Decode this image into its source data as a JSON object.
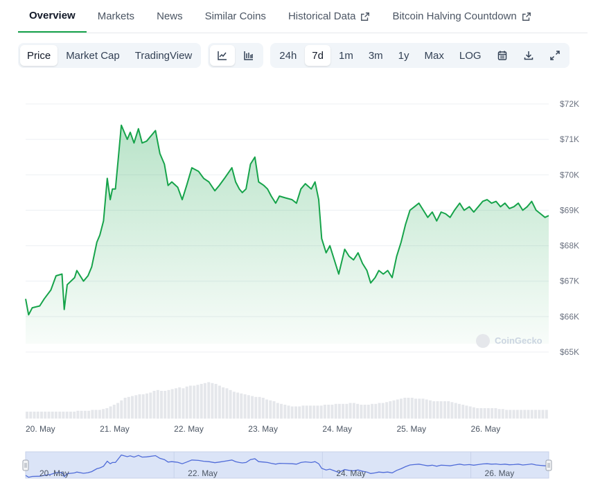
{
  "tabs": [
    {
      "label": "Overview",
      "active": true,
      "external": false
    },
    {
      "label": "Markets",
      "active": false,
      "external": false
    },
    {
      "label": "News",
      "active": false,
      "external": false
    },
    {
      "label": "Similar Coins",
      "active": false,
      "external": false
    },
    {
      "label": "Historical Data",
      "active": false,
      "external": true
    },
    {
      "label": "Bitcoin Halving Countdown",
      "active": false,
      "external": true
    }
  ],
  "toolbar": {
    "metric_buttons": [
      {
        "label": "Price",
        "active": true
      },
      {
        "label": "Market Cap",
        "active": false
      },
      {
        "label": "TradingView",
        "active": false
      }
    ],
    "chart_type_icons": [
      {
        "icon": "line-chart-icon",
        "active": true
      },
      {
        "icon": "candlestick-chart-icon",
        "active": false
      }
    ],
    "range_buttons": [
      {
        "label": "24h",
        "active": false
      },
      {
        "label": "7d",
        "active": true
      },
      {
        "label": "1m",
        "active": false
      },
      {
        "label": "3m",
        "active": false
      },
      {
        "label": "1y",
        "active": false
      },
      {
        "label": "Max",
        "active": false
      },
      {
        "label": "LOG",
        "active": false
      }
    ],
    "action_icons": [
      "calendar-icon",
      "download-icon",
      "fullscreen-icon"
    ]
  },
  "watermark": "CoinGecko",
  "colors": {
    "accent": "#16a34a",
    "line": "#16a34a",
    "navigator_line": "#4f6bd8",
    "navigator_fill": "#dbe4f7"
  },
  "chart_data": {
    "type": "line",
    "y_ticks": [
      "$72K",
      "$71K",
      "$70K",
      "$69K",
      "$68K",
      "$67K",
      "$66K",
      "$65K"
    ],
    "y_tick_values": [
      72000,
      71000,
      70000,
      69000,
      68000,
      67000,
      66000,
      65000
    ],
    "ylim": [
      65000,
      72000
    ],
    "x_ticks": [
      "20. May",
      "21. May",
      "22. May",
      "23. May",
      "24. May",
      "25. May",
      "26. May"
    ],
    "x_tick_values": [
      0,
      1,
      2,
      3,
      4,
      5,
      6
    ],
    "xlim": [
      0,
      7.05
    ],
    "navigator_ticks": [
      "20. May",
      "22. May",
      "24. May",
      "26. May"
    ],
    "navigator_tick_values": [
      0,
      2,
      4,
      6
    ],
    "grid": true,
    "series": [
      {
        "values": [
          [
            0.0,
            66500
          ],
          [
            0.04,
            66050
          ],
          [
            0.09,
            66250
          ],
          [
            0.19,
            66300
          ],
          [
            0.25,
            66500
          ],
          [
            0.34,
            66750
          ],
          [
            0.41,
            67150
          ],
          [
            0.49,
            67200
          ],
          [
            0.52,
            66200
          ],
          [
            0.56,
            66900
          ],
          [
            0.66,
            67100
          ],
          [
            0.69,
            67300
          ],
          [
            0.78,
            67000
          ],
          [
            0.84,
            67150
          ],
          [
            0.89,
            67400
          ],
          [
            0.96,
            68100
          ],
          [
            1.0,
            68300
          ],
          [
            1.05,
            68700
          ],
          [
            1.1,
            69900
          ],
          [
            1.14,
            69300
          ],
          [
            1.17,
            69600
          ],
          [
            1.21,
            69600
          ],
          [
            1.25,
            70500
          ],
          [
            1.29,
            71400
          ],
          [
            1.37,
            71000
          ],
          [
            1.41,
            71200
          ],
          [
            1.46,
            70900
          ],
          [
            1.52,
            71300
          ],
          [
            1.57,
            70900
          ],
          [
            1.63,
            70950
          ],
          [
            1.75,
            71250
          ],
          [
            1.81,
            70600
          ],
          [
            1.87,
            70300
          ],
          [
            1.92,
            69700
          ],
          [
            1.97,
            69800
          ],
          [
            2.05,
            69650
          ],
          [
            2.11,
            69300
          ],
          [
            2.17,
            69700
          ],
          [
            2.24,
            70200
          ],
          [
            2.33,
            70100
          ],
          [
            2.4,
            69900
          ],
          [
            2.47,
            69800
          ],
          [
            2.55,
            69550
          ],
          [
            2.61,
            69700
          ],
          [
            2.68,
            69900
          ],
          [
            2.78,
            70200
          ],
          [
            2.83,
            69800
          ],
          [
            2.88,
            69600
          ],
          [
            2.92,
            69500
          ],
          [
            2.97,
            69600
          ],
          [
            3.03,
            70300
          ],
          [
            3.09,
            70500
          ],
          [
            3.14,
            69800
          ],
          [
            3.21,
            69700
          ],
          [
            3.26,
            69600
          ],
          [
            3.31,
            69400
          ],
          [
            3.37,
            69200
          ],
          [
            3.42,
            69400
          ],
          [
            3.5,
            69350
          ],
          [
            3.59,
            69300
          ],
          [
            3.65,
            69200
          ],
          [
            3.71,
            69600
          ],
          [
            3.77,
            69750
          ],
          [
            3.85,
            69600
          ],
          [
            3.9,
            69800
          ],
          [
            3.95,
            69300
          ],
          [
            3.99,
            68200
          ],
          [
            4.05,
            67800
          ],
          [
            4.1,
            68000
          ],
          [
            4.16,
            67600
          ],
          [
            4.22,
            67200
          ],
          [
            4.3,
            67900
          ],
          [
            4.36,
            67700
          ],
          [
            4.42,
            67600
          ],
          [
            4.48,
            67800
          ],
          [
            4.54,
            67500
          ],
          [
            4.6,
            67300
          ],
          [
            4.65,
            66950
          ],
          [
            4.71,
            67100
          ],
          [
            4.76,
            67300
          ],
          [
            4.82,
            67200
          ],
          [
            4.88,
            67300
          ],
          [
            4.94,
            67100
          ],
          [
            5.0,
            67700
          ],
          [
            5.06,
            68100
          ],
          [
            5.12,
            68600
          ],
          [
            5.18,
            69000
          ],
          [
            5.24,
            69100
          ],
          [
            5.3,
            69200
          ],
          [
            5.36,
            69000
          ],
          [
            5.42,
            68800
          ],
          [
            5.48,
            68950
          ],
          [
            5.54,
            68700
          ],
          [
            5.6,
            68950
          ],
          [
            5.66,
            68900
          ],
          [
            5.72,
            68800
          ],
          [
            5.78,
            69000
          ],
          [
            5.85,
            69200
          ],
          [
            5.91,
            69000
          ],
          [
            5.98,
            69100
          ],
          [
            6.04,
            68950
          ],
          [
            6.1,
            69100
          ],
          [
            6.16,
            69250
          ],
          [
            6.22,
            69300
          ],
          [
            6.28,
            69200
          ],
          [
            6.34,
            69250
          ],
          [
            6.4,
            69100
          ],
          [
            6.46,
            69200
          ],
          [
            6.52,
            69050
          ],
          [
            6.58,
            69100
          ],
          [
            6.64,
            69200
          ],
          [
            6.7,
            69000
          ],
          [
            6.76,
            69100
          ],
          [
            6.82,
            69250
          ],
          [
            6.88,
            69000
          ],
          [
            6.94,
            68900
          ],
          [
            7.0,
            68800
          ],
          [
            7.05,
            68850
          ]
        ]
      }
    ],
    "volume": [
      8,
      8,
      8,
      8,
      8,
      8,
      8,
      8,
      8,
      8,
      8,
      8,
      8,
      8,
      9,
      9,
      9,
      9,
      10,
      10,
      10,
      11,
      12,
      14,
      16,
      18,
      21,
      24,
      25,
      26,
      27,
      28,
      28,
      29,
      30,
      32,
      33,
      32,
      32,
      33,
      34,
      35,
      36,
      35,
      37,
      38,
      38,
      39,
      40,
      41,
      42,
      41,
      40,
      38,
      36,
      35,
      33,
      31,
      30,
      29,
      28,
      27,
      26,
      25,
      25,
      24,
      22,
      21,
      20,
      18,
      17,
      16,
      15,
      14,
      14,
      14,
      15,
      15,
      15,
      15,
      15,
      15,
      16,
      16,
      16,
      17,
      17,
      17,
      17,
      18,
      18,
      17,
      16,
      16,
      16,
      17,
      17,
      18,
      18,
      19,
      20,
      21,
      22,
      23,
      24,
      24,
      24,
      23,
      23,
      23,
      22,
      21,
      20,
      20,
      20,
      20,
      20,
      19,
      18,
      17,
      16,
      15,
      14,
      13,
      12,
      12,
      12,
      12,
      12,
      12,
      11,
      11,
      10,
      10,
      10,
      10,
      10,
      10,
      10,
      10,
      10,
      10,
      10,
      10
    ]
  }
}
